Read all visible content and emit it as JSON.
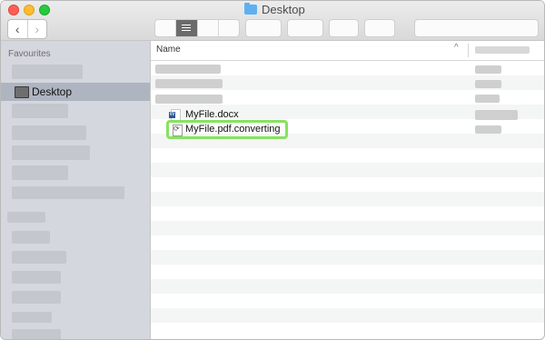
{
  "window": {
    "title": "Desktop",
    "nav": {
      "back_glyph": "‹",
      "forward_glyph": "›"
    },
    "icons": {
      "title": "folder-icon",
      "view": "list-view-icon"
    }
  },
  "sidebar": {
    "section_title": "Favourites",
    "selected_item": {
      "label": "Desktop",
      "icon": "desktop-icon"
    }
  },
  "file_list": {
    "column_name": "Name",
    "sort_indicator": "^",
    "files": [
      {
        "name": "MyFile.docx",
        "icon": "word-doc-icon"
      },
      {
        "name": "MyFile.pdf.converting",
        "icon": "converting-file-icon"
      }
    ]
  },
  "colors": {
    "highlight": "#86e35f",
    "sidebar_selected": "#aeb4c0",
    "sidebar_bg": "#d4d7de"
  }
}
